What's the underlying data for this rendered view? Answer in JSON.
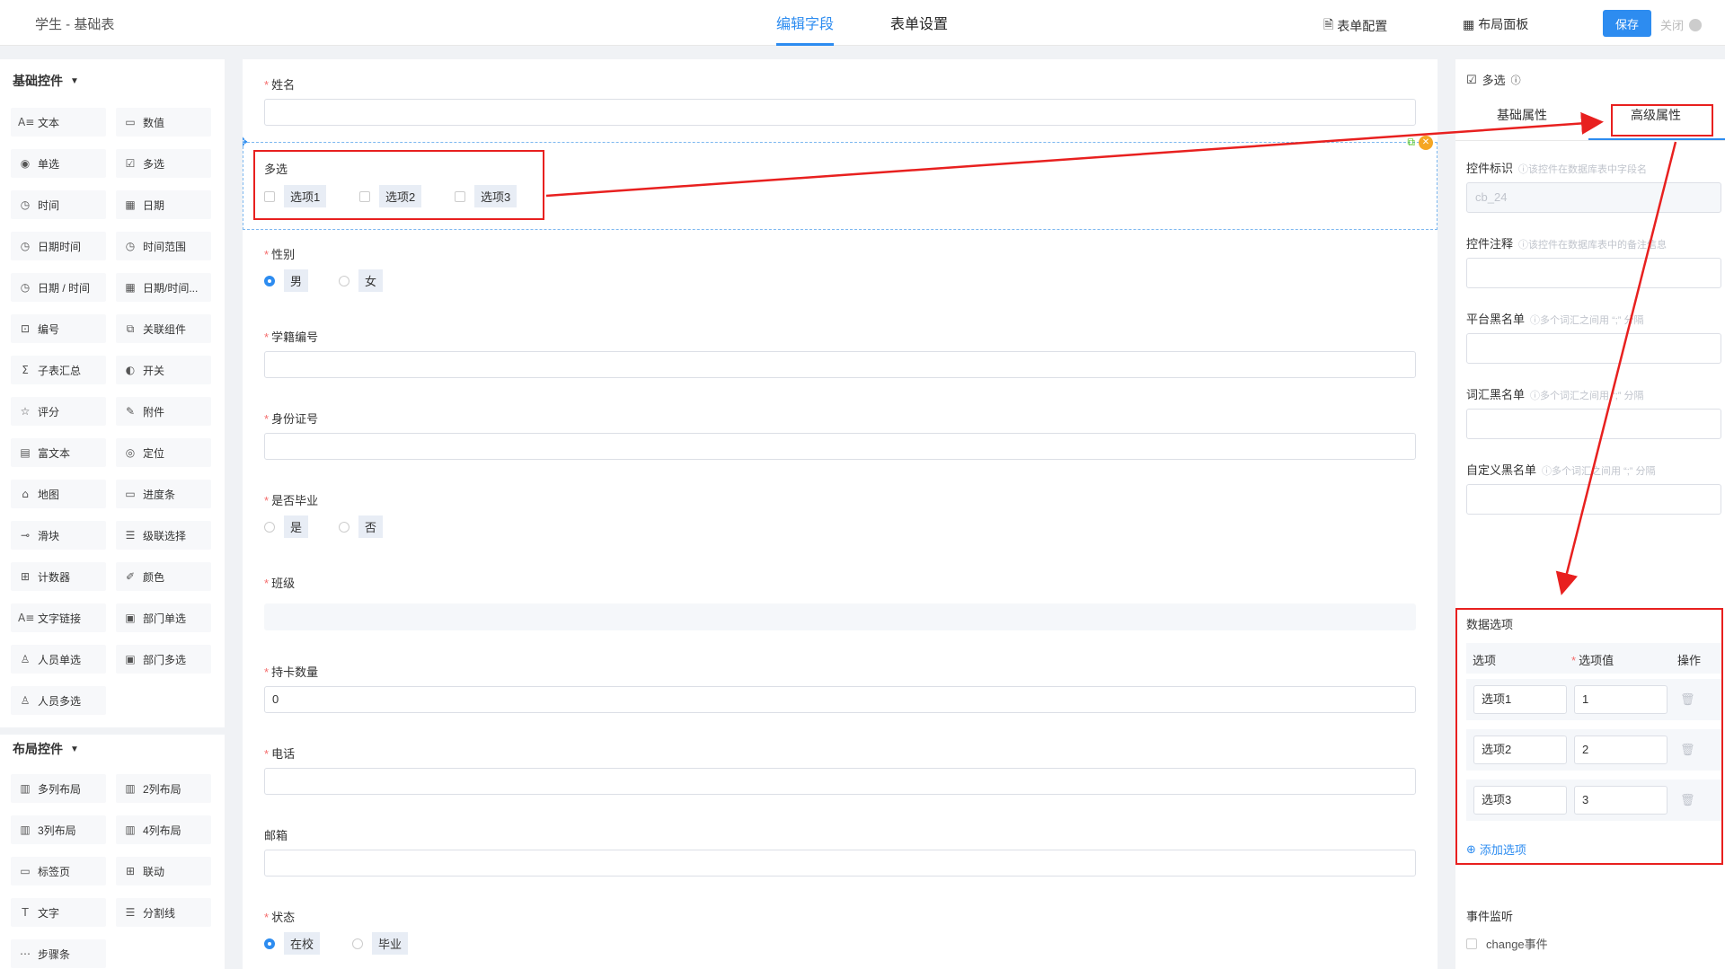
{
  "header": {
    "app_title": "学生 - 基础表",
    "tabs": [
      {
        "label": "编辑字段",
        "active": true
      },
      {
        "label": "表单设置",
        "active": false
      }
    ],
    "form_config": "表单配置",
    "layout_panel": "布局面板",
    "save": "保存",
    "close": "关闭"
  },
  "left_panel": {
    "basic_title": "基础控件",
    "basic_widgets": [
      {
        "label": "文本",
        "icon": "text-icon"
      },
      {
        "label": "数值",
        "icon": "number-icon"
      },
      {
        "label": "单选",
        "icon": "radio-icon"
      },
      {
        "label": "多选",
        "icon": "checkbox-icon"
      },
      {
        "label": "时间",
        "icon": "clock-icon"
      },
      {
        "label": "日期",
        "icon": "calendar-icon"
      },
      {
        "label": "日期时间",
        "icon": "clock-icon"
      },
      {
        "label": "时间范围",
        "icon": "clock-icon"
      },
      {
        "label": "日期 / 时间",
        "icon": "clock-icon"
      },
      {
        "label": "日期/时间...",
        "icon": "calendar-icon"
      },
      {
        "label": "编号",
        "icon": "serial-icon"
      },
      {
        "label": "关联组件",
        "icon": "link-icon"
      },
      {
        "label": "子表汇总",
        "icon": "sigma-icon"
      },
      {
        "label": "开关",
        "icon": "switch-icon"
      },
      {
        "label": "评分",
        "icon": "star-icon"
      },
      {
        "label": "附件",
        "icon": "paperclip-icon"
      },
      {
        "label": "富文本",
        "icon": "richtext-icon"
      },
      {
        "label": "定位",
        "icon": "location-icon"
      },
      {
        "label": "地图",
        "icon": "map-icon"
      },
      {
        "label": "进度条",
        "icon": "progress-icon"
      },
      {
        "label": "滑块",
        "icon": "slider-icon"
      },
      {
        "label": "级联选择",
        "icon": "cascade-icon"
      },
      {
        "label": "计数器",
        "icon": "counter-icon"
      },
      {
        "label": "颜色",
        "icon": "color-picker-icon"
      },
      {
        "label": "文字链接",
        "icon": "text-link-icon"
      },
      {
        "label": "部门单选",
        "icon": "department-icon"
      },
      {
        "label": "人员单选",
        "icon": "user-icon"
      },
      {
        "label": "部门多选",
        "icon": "department-icon"
      },
      {
        "label": "人员多选",
        "icon": "users-icon"
      }
    ],
    "layout_title": "布局控件",
    "layout_widgets": [
      {
        "label": "多列布局",
        "icon": "columns-icon"
      },
      {
        "label": "2列布局",
        "icon": "columns-icon"
      },
      {
        "label": "3列布局",
        "icon": "columns-icon"
      },
      {
        "label": "4列布局",
        "icon": "columns-icon"
      },
      {
        "label": "标签页",
        "icon": "tabs-icon"
      },
      {
        "label": "联动",
        "icon": "grid-icon"
      },
      {
        "label": "文字",
        "icon": "text-t-icon"
      },
      {
        "label": "分割线",
        "icon": "divider-icon"
      },
      {
        "label": "步骤条",
        "icon": "steps-icon"
      }
    ]
  },
  "canvas": {
    "name_label": "姓名",
    "multi_label": "多选",
    "multi_options": [
      "选项1",
      "选项2",
      "选项3"
    ],
    "gender_label": "性别",
    "gender_options": [
      "男",
      "女"
    ],
    "student_no_label": "学籍编号",
    "id_label": "身份证号",
    "graduated_label": "是否毕业",
    "graduated_options": [
      "是",
      "否"
    ],
    "class_label": "班级",
    "card_count_label": "持卡数量",
    "card_count_value": "0",
    "phone_label": "电话",
    "email_label": "邮箱",
    "status_label": "状态",
    "status_options": [
      "在校",
      "毕业"
    ]
  },
  "right_panel": {
    "title": "多选",
    "tabs": [
      "基础属性",
      "高级属性"
    ],
    "field_id_label": "控件标识",
    "field_id_hint": "ⓘ该控件在数据库表中字段名",
    "field_id_value": "cb_24",
    "comment_label": "控件注释",
    "comment_hint": "ⓘ该控件在数据库表中的备注信息",
    "platform_blacklist_label": "平台黑名单",
    "platform_blacklist_hint": "ⓘ多个词汇之间用 “;” 分隔",
    "word_blacklist_label": "词汇黑名单",
    "word_blacklist_hint": "ⓘ多个词汇之间用 “;” 分隔",
    "custom_blacklist_label": "自定义黑名单",
    "custom_blacklist_hint": "ⓘ多个词汇之间用 “;” 分隔",
    "data_options_title": "数据选项",
    "col_option": "选项",
    "col_value": "选项值",
    "col_action": "操作",
    "options": [
      {
        "label": "选项1",
        "value": "1"
      },
      {
        "label": "选项2",
        "value": "2"
      },
      {
        "label": "选项3",
        "value": "3"
      }
    ],
    "add_option": "添加选项",
    "event_title": "事件监听",
    "change_event": "change事件"
  },
  "colors": {
    "accent": "#2d8cf0",
    "annotation_red": "#e8201f",
    "required": "#f56c6c"
  }
}
